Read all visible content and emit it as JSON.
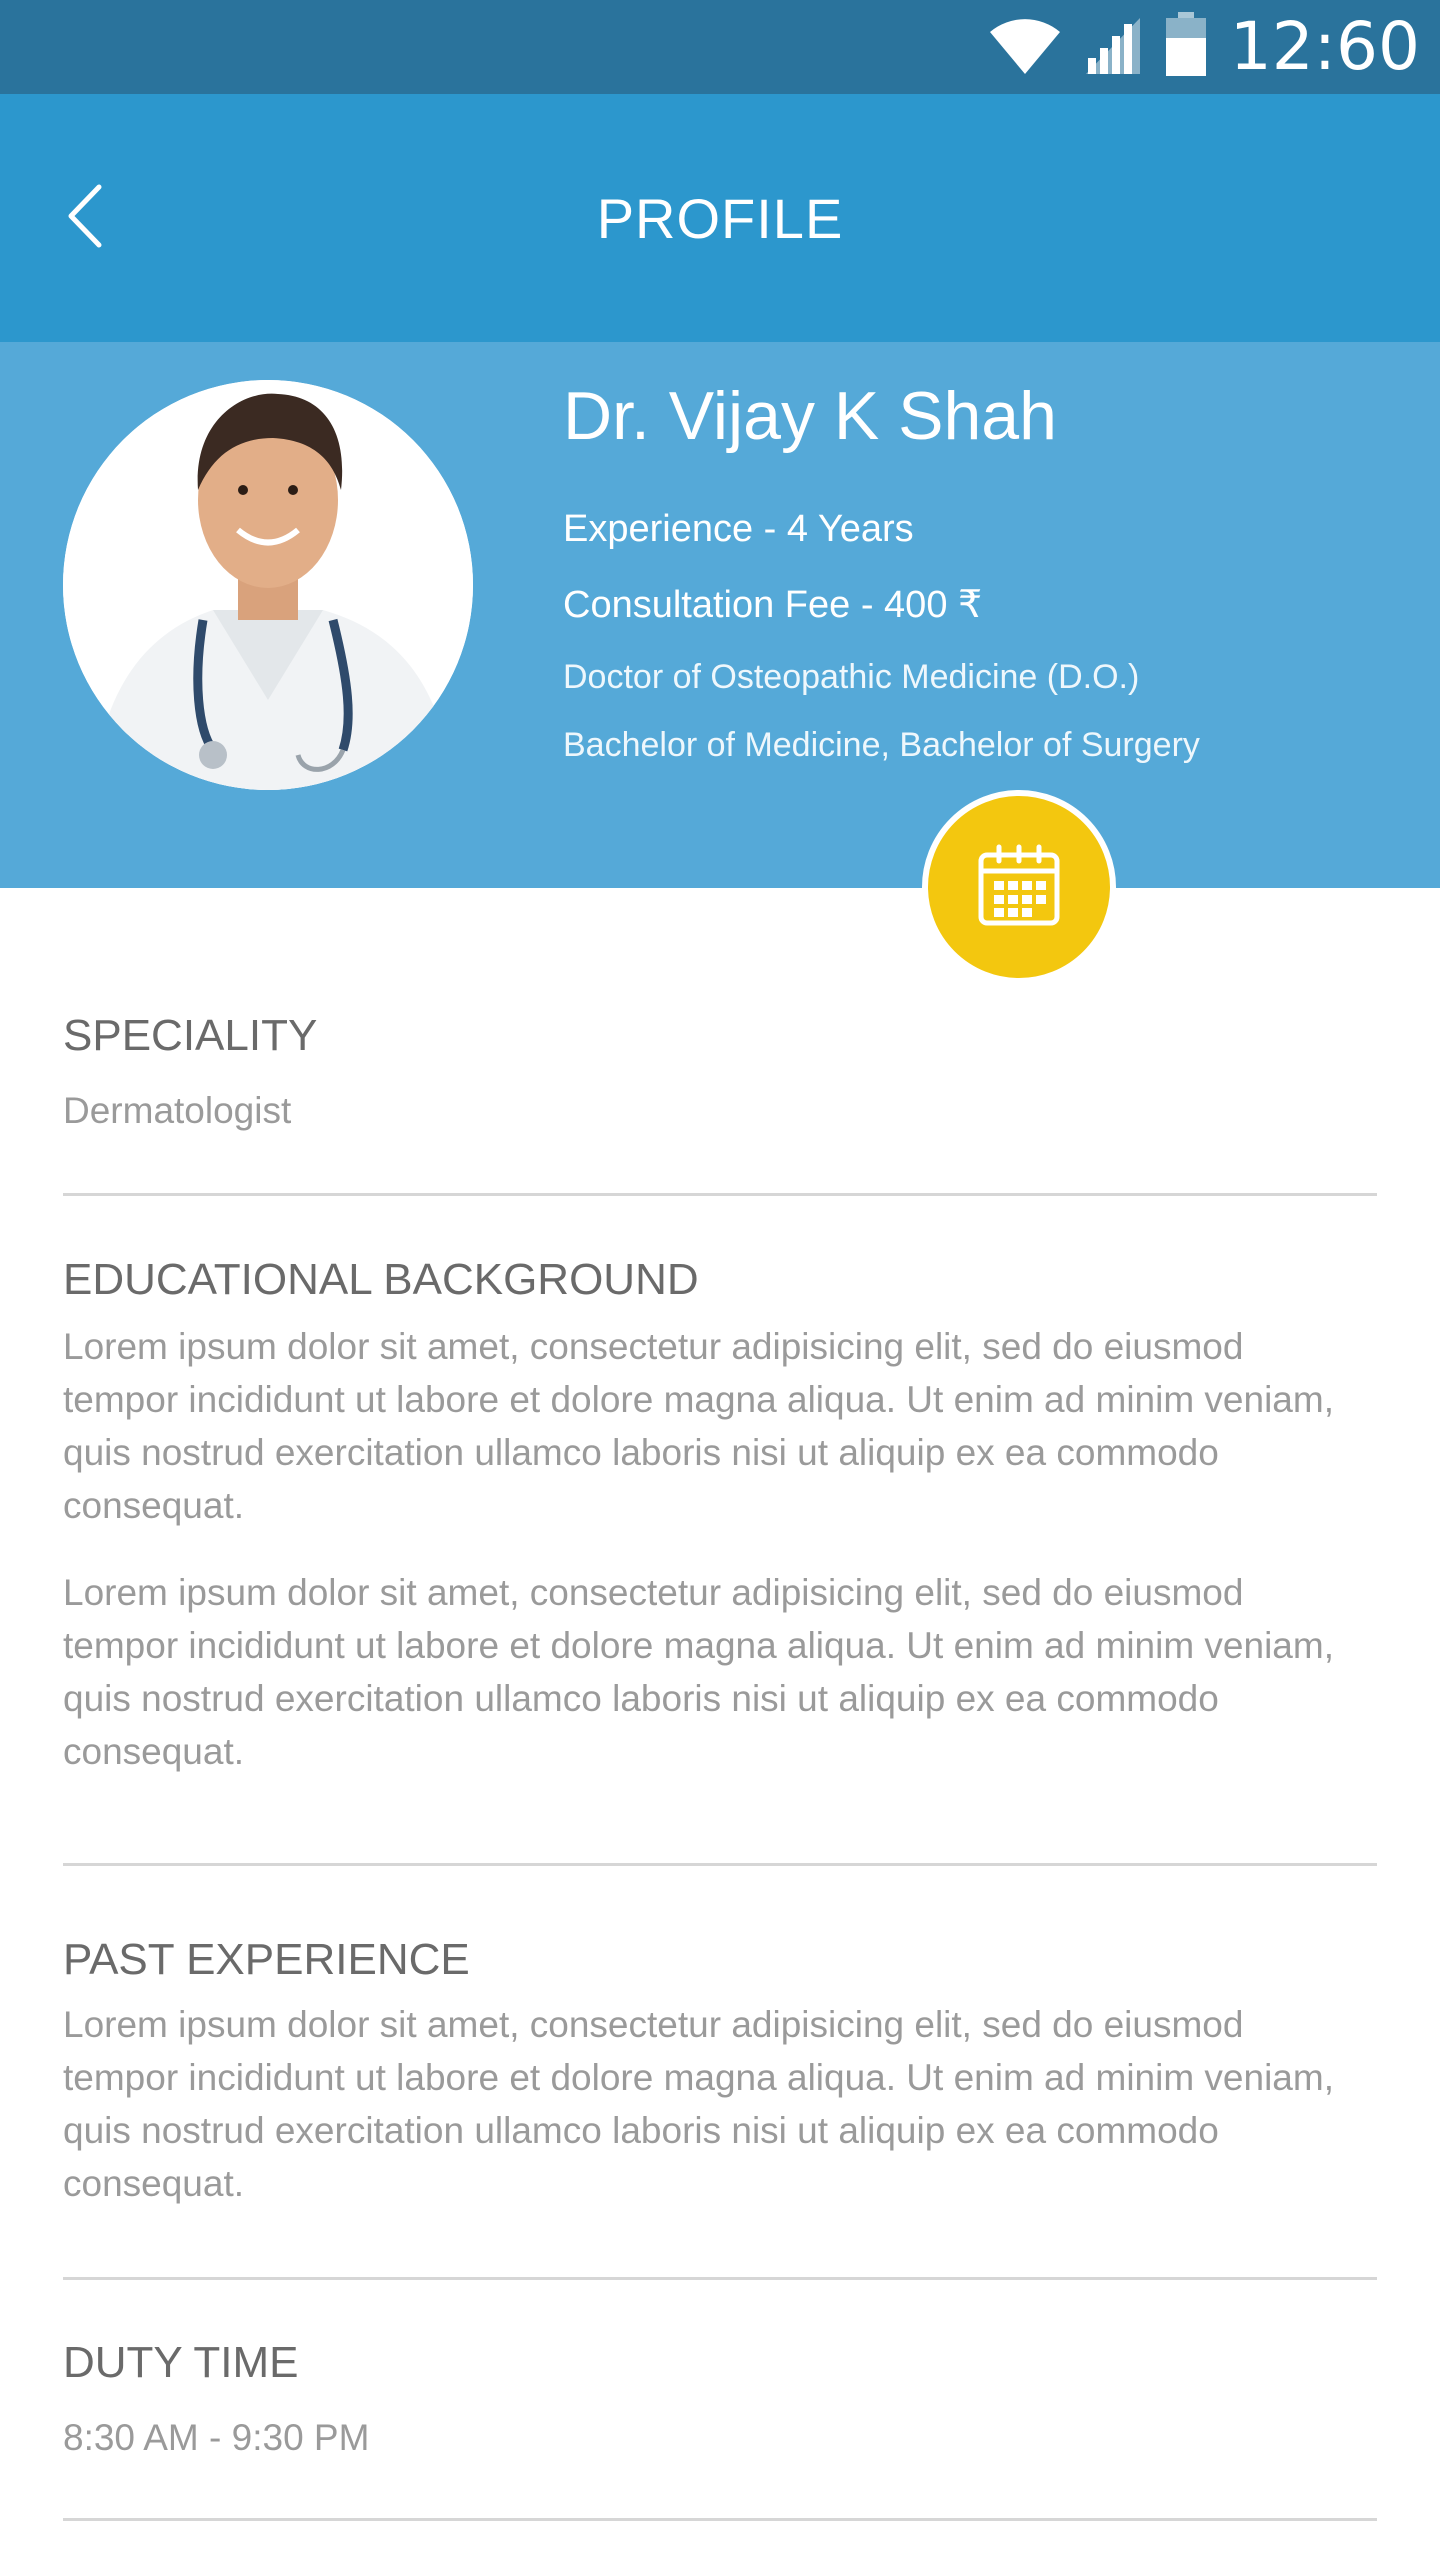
{
  "status_bar": {
    "time": "12:60",
    "icons": [
      "wifi-icon",
      "signal-icon",
      "battery-icon"
    ]
  },
  "app_bar": {
    "title": "PROFILE",
    "back_icon": "chevron-left-icon"
  },
  "profile": {
    "name": "Dr. Vijay K Shah",
    "experience": "Experience - 4 Years",
    "fee": "Consultation Fee - 400 ₹",
    "degrees": [
      "Doctor of Osteopathic Medicine (D.O.)",
      "Bachelor of Medicine, Bachelor of Surgery"
    ],
    "calendar_icon": "calendar-icon"
  },
  "sections": {
    "speciality": {
      "title": "SPECIALITY",
      "value": "Dermatologist"
    },
    "education": {
      "title": "EDUCATIONAL BACKGROUND",
      "paragraphs": [
        "Lorem ipsum dolor sit amet, consectetur adipisicing elit, sed do eiusmod tempor incididunt ut labore et dolore magna aliqua. Ut enim ad minim veniam, quis nostrud exercitation ullamco laboris nisi ut aliquip ex ea commodo consequat.",
        "Lorem ipsum dolor sit amet, consectetur adipisicing elit, sed do eiusmod tempor incididunt ut labore et dolore magna aliqua. Ut enim ad minim veniam, quis nostrud exercitation ullamco laboris nisi ut aliquip ex ea commodo consequat."
      ]
    },
    "experience": {
      "title": "PAST EXPERIENCE",
      "paragraph": "Lorem ipsum dolor sit amet, consectetur adipisicing elit, sed do eiusmod tempor incididunt ut labore et dolore magna aliqua. Ut enim ad minim veniam, quis nostrud exercitation ullamco laboris nisi ut aliquip ex ea commodo consequat."
    },
    "duty": {
      "title": "DUTY TIME",
      "value": "8:30 AM - 9:30 PM"
    }
  },
  "colors": {
    "status_bar": "#2a739c",
    "app_bar": "#2c97cd",
    "profile_header": "#55a9d8",
    "accent": "#f3c70f"
  }
}
